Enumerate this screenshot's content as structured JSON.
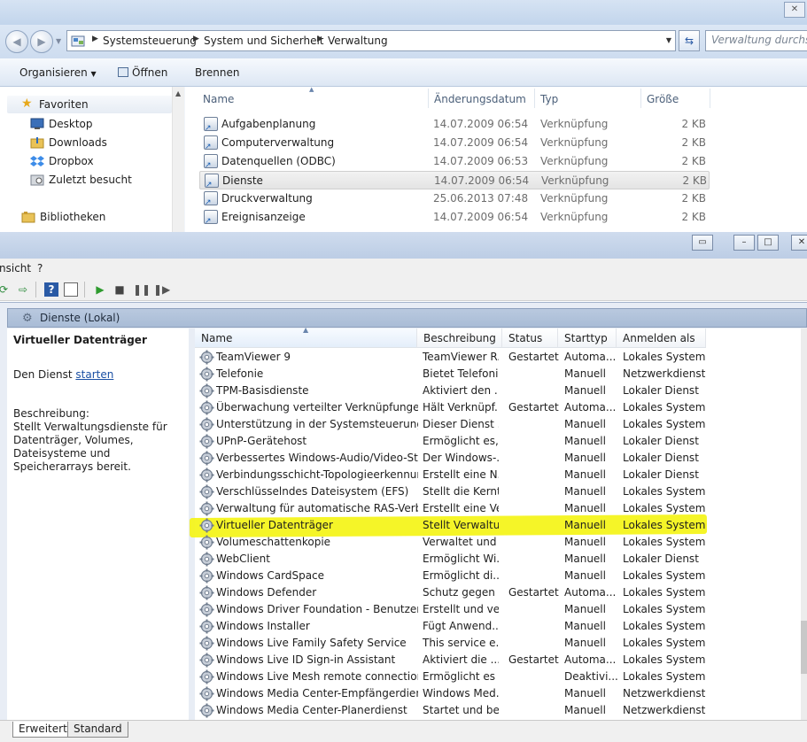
{
  "explorer": {
    "address": {
      "crumbs": [
        "Systemsteuerung",
        "System und Sicherheit",
        "Verwaltung"
      ],
      "search_placeholder": "Verwaltung durchsuchen"
    },
    "toolbar": {
      "organize": "Organisieren",
      "open": "Öffnen",
      "burn": "Brennen"
    },
    "nav": {
      "favorites": "Favoriten",
      "items": [
        "Desktop",
        "Downloads",
        "Dropbox",
        "Zuletzt besucht"
      ],
      "libraries": "Bibliotheken"
    },
    "columns": {
      "name": "Name",
      "date": "Änderungsdatum",
      "type": "Typ",
      "size": "Größe"
    },
    "files": [
      {
        "name": "Aufgabenplanung",
        "date": "14.07.2009 06:54",
        "type": "Verknüpfung",
        "size": "2 KB"
      },
      {
        "name": "Computerverwaltung",
        "date": "14.07.2009 06:54",
        "type": "Verknüpfung",
        "size": "2 KB"
      },
      {
        "name": "Datenquellen (ODBC)",
        "date": "14.07.2009 06:53",
        "type": "Verknüpfung",
        "size": "2 KB"
      },
      {
        "name": "Dienste",
        "date": "14.07.2009 06:54",
        "type": "Verknüpfung",
        "size": "2 KB"
      },
      {
        "name": "Druckverwaltung",
        "date": "25.06.2013 07:48",
        "type": "Verknüpfung",
        "size": "2 KB"
      },
      {
        "name": "Ereignisanzeige",
        "date": "14.07.2009 06:54",
        "type": "Verknüpfung",
        "size": "2 KB"
      }
    ]
  },
  "services": {
    "menu": {
      "view_partial": "nsicht",
      "help": "?"
    },
    "panel_header": "Dienste (Lokal)",
    "detail": {
      "title": "Virtueller Datenträger",
      "action_prefix": "Den Dienst",
      "action_link": "starten",
      "desc_label": "Beschreibung:",
      "desc": "Stellt Verwaltungsdienste für Datenträger, Volumes, Dateisysteme und Speicherarrays bereit."
    },
    "columns": {
      "name": "Name",
      "desc": "Beschreibung",
      "status": "Status",
      "start": "Starttyp",
      "logon": "Anmelden als"
    },
    "rows": [
      {
        "name": "TeamViewer 9",
        "desc": "TeamViewer R...",
        "status": "Gestartet",
        "start": "Automa...",
        "logon": "Lokales System"
      },
      {
        "name": "Telefonie",
        "desc": "Bietet Telefoni...",
        "status": "",
        "start": "Manuell",
        "logon": "Netzwerkdienst"
      },
      {
        "name": "TPM-Basisdienste",
        "desc": "Aktiviert den ...",
        "status": "",
        "start": "Manuell",
        "logon": "Lokaler Dienst"
      },
      {
        "name": "Überwachung verteilter Verknüpfungen (...",
        "desc": "Hält Verknüpf...",
        "status": "Gestartet",
        "start": "Automa...",
        "logon": "Lokales System"
      },
      {
        "name": "Unterstützung in der Systemsteuerung u...",
        "desc": "Dieser Dienst ...",
        "status": "",
        "start": "Manuell",
        "logon": "Lokales System"
      },
      {
        "name": "UPnP-Gerätehost",
        "desc": "Ermöglicht es,...",
        "status": "",
        "start": "Manuell",
        "logon": "Lokaler Dienst"
      },
      {
        "name": "Verbessertes Windows-Audio/Video-Stre...",
        "desc": "Der Windows-...",
        "status": "",
        "start": "Manuell",
        "logon": "Lokaler Dienst"
      },
      {
        "name": "Verbindungsschicht-Topologieerkennun...",
        "desc": "Erstellt eine N...",
        "status": "",
        "start": "Manuell",
        "logon": "Lokaler Dienst"
      },
      {
        "name": "Verschlüsselndes Dateisystem (EFS)",
        "desc": "Stellt die Kernt...",
        "status": "",
        "start": "Manuell",
        "logon": "Lokales System"
      },
      {
        "name": "Verwaltung für automatische RAS-Verbin...",
        "desc": "Erstellt eine Ve...",
        "status": "",
        "start": "Manuell",
        "logon": "Lokales System"
      },
      {
        "name": "Virtueller Datenträger",
        "desc": "Stellt Verwaltu...",
        "status": "",
        "start": "Manuell",
        "logon": "Lokales System"
      },
      {
        "name": "Volumeschattenkopie",
        "desc": "Verwaltet und ...",
        "status": "",
        "start": "Manuell",
        "logon": "Lokales System"
      },
      {
        "name": "WebClient",
        "desc": "Ermöglicht Wi...",
        "status": "",
        "start": "Manuell",
        "logon": "Lokaler Dienst"
      },
      {
        "name": "Windows CardSpace",
        "desc": "Ermöglicht di...",
        "status": "",
        "start": "Manuell",
        "logon": "Lokales System"
      },
      {
        "name": "Windows Defender",
        "desc": "Schutz gegen ...",
        "status": "Gestartet",
        "start": "Automa...",
        "logon": "Lokales System"
      },
      {
        "name": "Windows Driver Foundation - Benutzerm...",
        "desc": "Erstellt und ve...",
        "status": "",
        "start": "Manuell",
        "logon": "Lokales System"
      },
      {
        "name": "Windows Installer",
        "desc": "Fügt Anwend...",
        "status": "",
        "start": "Manuell",
        "logon": "Lokales System"
      },
      {
        "name": "Windows Live Family Safety Service",
        "desc": "This service e...",
        "status": "",
        "start": "Manuell",
        "logon": "Lokales System"
      },
      {
        "name": "Windows Live ID Sign-in Assistant",
        "desc": "Aktiviert die ...",
        "status": "Gestartet",
        "start": "Automa...",
        "logon": "Lokales System"
      },
      {
        "name": "Windows Live Mesh remote connections...",
        "desc": "Ermöglicht es ...",
        "status": "",
        "start": "Deaktivi...",
        "logon": "Lokales System"
      },
      {
        "name": "Windows Media Center-Empfängerdienst",
        "desc": "Windows Med...",
        "status": "",
        "start": "Manuell",
        "logon": "Netzwerkdienst"
      },
      {
        "name": "Windows Media Center-Planerdienst",
        "desc": "Startet und be...",
        "status": "",
        "start": "Manuell",
        "logon": "Netzwerkdienst"
      }
    ],
    "tabs": {
      "extended": "Erweitert",
      "standard": "Standard"
    }
  },
  "colors": {
    "highlight": "#f4f41c",
    "link": "#1a4fa3",
    "header_bg": "#b9c9df"
  }
}
